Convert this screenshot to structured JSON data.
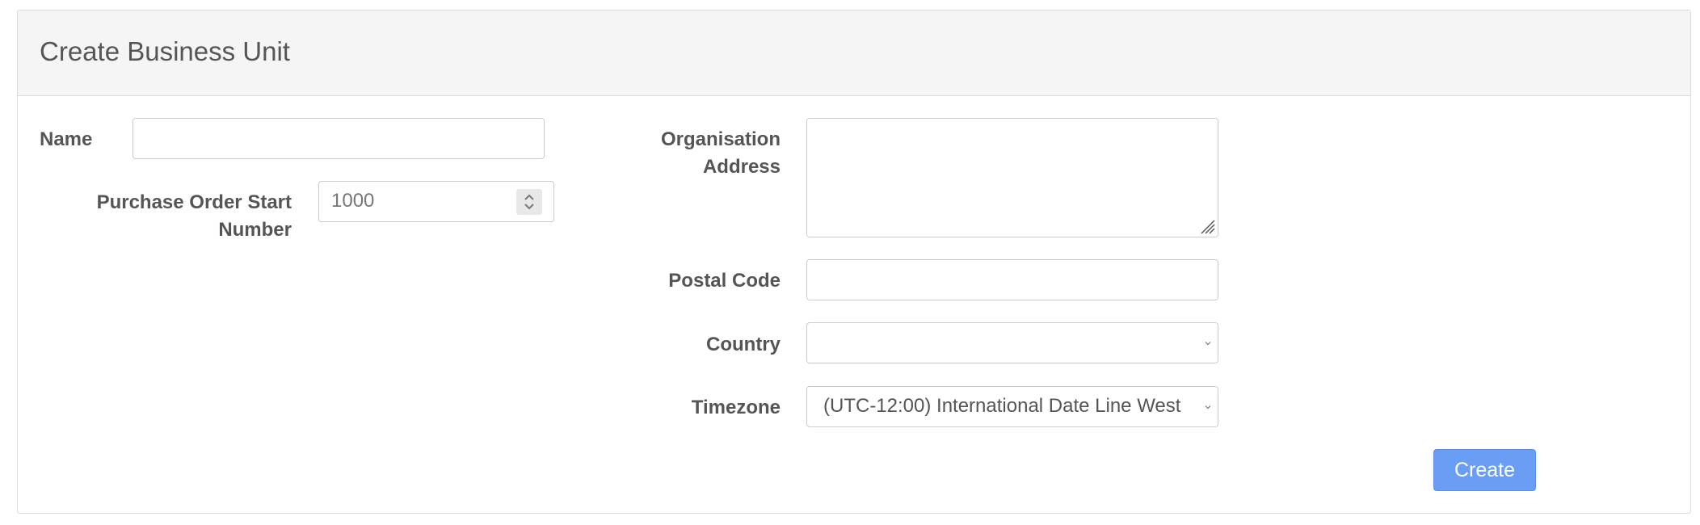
{
  "panel": {
    "title": "Create Business Unit"
  },
  "form": {
    "name": {
      "label": "Name",
      "value": ""
    },
    "purchase_order_start_number": {
      "label_line1": "Purchase Order Start",
      "label_line2": "Number",
      "value": "1000"
    },
    "organisation_address": {
      "label_line1": "Organisation",
      "label_line2": "Address",
      "value": ""
    },
    "postal_code": {
      "label": "Postal Code",
      "value": ""
    },
    "country": {
      "label": "Country",
      "selected": ""
    },
    "timezone": {
      "label": "Timezone",
      "selected": "(UTC-12:00) International Date Line West"
    }
  },
  "actions": {
    "create_label": "Create"
  },
  "icons": {
    "spinner": "up-down-stepper-icon",
    "resize": "resize-grip-icon",
    "select": "chevron-down-icon"
  },
  "colors": {
    "primary_button": "#6a9ef5",
    "header_bg": "#f5f5f5",
    "label_text": "#555555",
    "border": "#cccccc"
  }
}
